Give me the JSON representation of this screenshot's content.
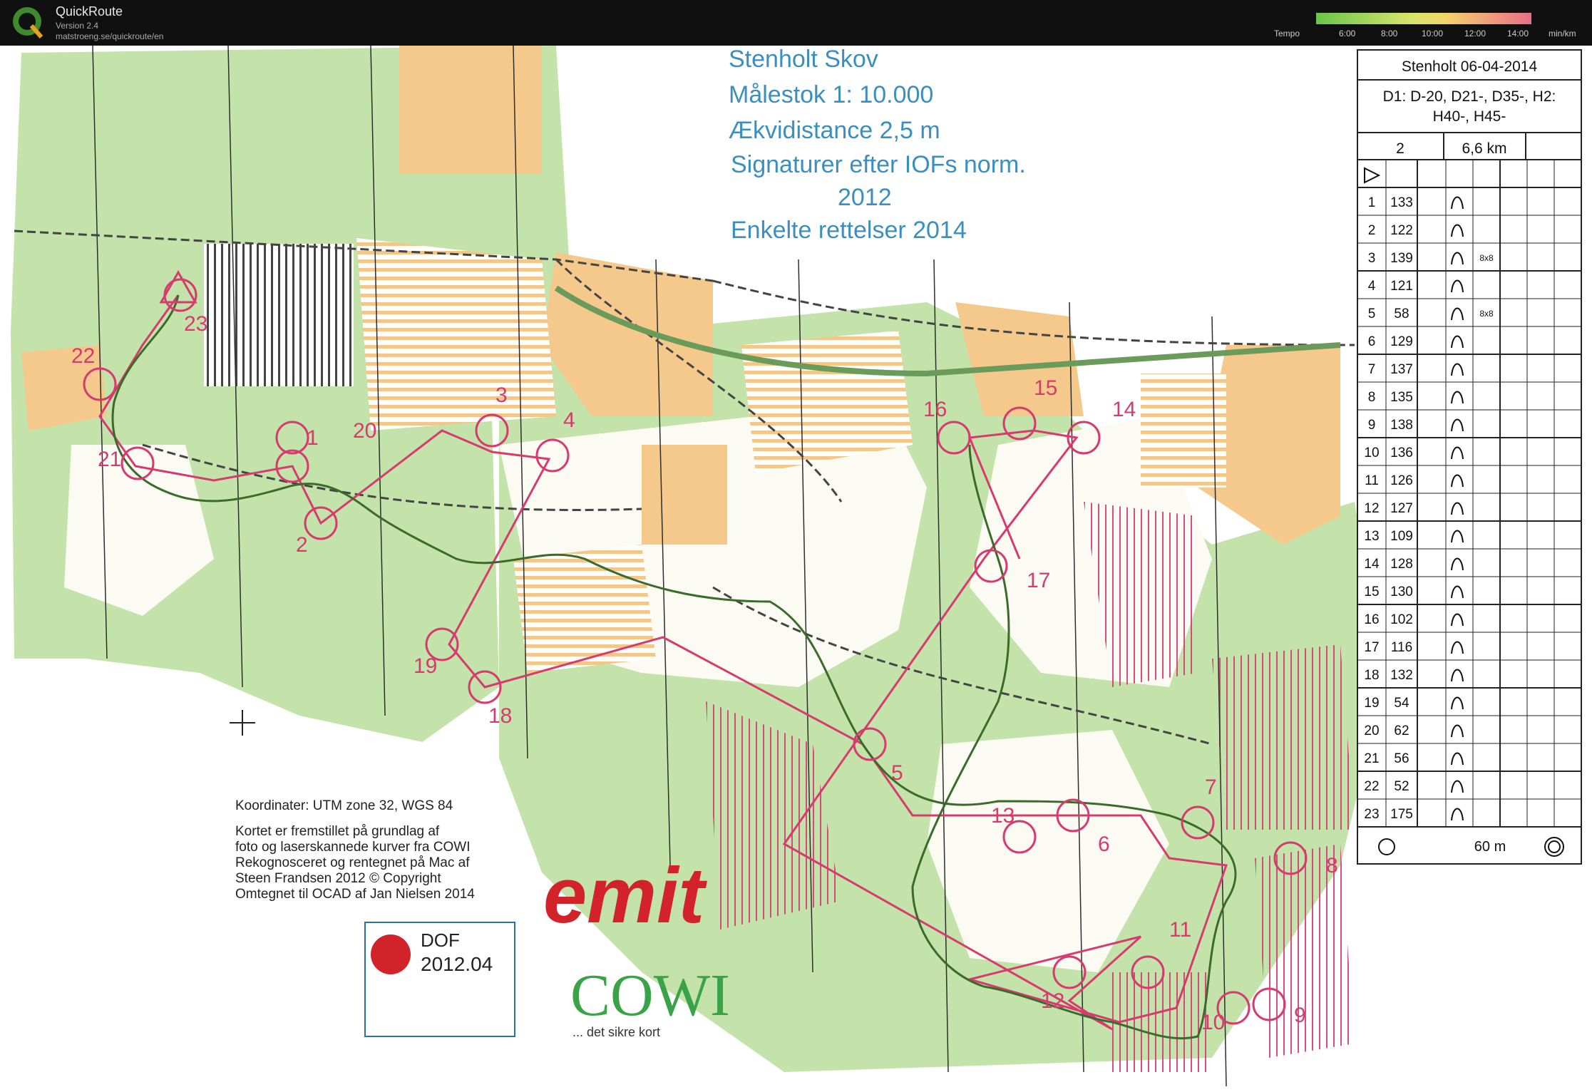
{
  "app": {
    "title": "QuickRoute",
    "version": "Version 2.4",
    "url": "matstroeng.se/quickroute/en",
    "tempo_label": "Tempo",
    "tempo_ticks": [
      "6:00",
      "8:00",
      "10:00",
      "12:00",
      "14:00"
    ],
    "tempo_unit": "min/km"
  },
  "map_info": {
    "line1": "Stenholt Skov",
    "line2": "Målestok    1: 10.000",
    "line3": "Ækvidistance 2,5 m",
    "line4": "Signaturer efter IOFs norm.",
    "line5": "2012",
    "line6": "Enkelte rettelser 2014"
  },
  "credits": {
    "coords": "Koordinater: UTM zone 32, WGS 84",
    "l1": "Kortet er fremstillet på grundlag af",
    "l2": "foto og laserskannede kurver fra COWI",
    "l3": "Rekognosceret og rentegnet på Mac af",
    "l4": "Steen Frandsen    2012      © Copyright",
    "l5": "Omtegnet til OCAD af Jan Nielsen 2014"
  },
  "logos": {
    "dof_name": "DOF",
    "dof_version": "2012.04",
    "emit": "emit",
    "cowi": "COWI",
    "cowi_tagline": "... det sikre kort"
  },
  "description_sheet": {
    "header": "Stenholt 06-04-2014",
    "classes_1": "D1: D-20, D21-, D35-, H2:",
    "classes_2": "H40-, H45-",
    "course": "2",
    "length": "6,6 km",
    "controls": [
      {
        "n": "1",
        "code": "133"
      },
      {
        "n": "2",
        "code": "122"
      },
      {
        "n": "3",
        "code": "139",
        "extra": "8x8"
      },
      {
        "n": "4",
        "code": "121"
      },
      {
        "n": "5",
        "code": "58",
        "extra": "8x8"
      },
      {
        "n": "6",
        "code": "129"
      },
      {
        "n": "7",
        "code": "137"
      },
      {
        "n": "8",
        "code": "135"
      },
      {
        "n": "9",
        "code": "138"
      },
      {
        "n": "10",
        "code": "136"
      },
      {
        "n": "11",
        "code": "126"
      },
      {
        "n": "12",
        "code": "127"
      },
      {
        "n": "13",
        "code": "109"
      },
      {
        "n": "14",
        "code": "128"
      },
      {
        "n": "15",
        "code": "130"
      },
      {
        "n": "16",
        "code": "102"
      },
      {
        "n": "17",
        "code": "116"
      },
      {
        "n": "18",
        "code": "132"
      },
      {
        "n": "19",
        "code": "54"
      },
      {
        "n": "20",
        "code": "62"
      },
      {
        "n": "21",
        "code": "56"
      },
      {
        "n": "22",
        "code": "52"
      },
      {
        "n": "23",
        "code": "175"
      }
    ],
    "finish": "60 m"
  },
  "control_labels": [
    "1",
    "2",
    "3",
    "4",
    "5",
    "6",
    "7",
    "8",
    "9",
    "10",
    "11",
    "12",
    "13",
    "14",
    "15",
    "16",
    "17",
    "18",
    "19",
    "20",
    "21",
    "22",
    "23"
  ],
  "colors": {
    "course": "#d63a6e",
    "route": "#3a6b2a",
    "forest": "#b9dca0",
    "open": "#f2c27a",
    "title_blue": "#3a8fbf"
  }
}
